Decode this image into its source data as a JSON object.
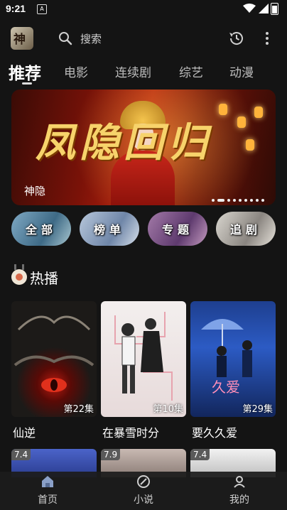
{
  "status_bar": {
    "time": "9:21"
  },
  "top_bar": {
    "logo_text": "神",
    "search_placeholder": "搜索"
  },
  "tabs": [
    {
      "label": "推荐",
      "active": true
    },
    {
      "label": "电影"
    },
    {
      "label": "连续剧"
    },
    {
      "label": "综艺"
    },
    {
      "label": "动漫"
    }
  ],
  "banner": {
    "title_art": "凤隐回归",
    "subtitle": "神隐",
    "slide_count": 9,
    "active_slide": 1
  },
  "categories": [
    {
      "label": "全部"
    },
    {
      "label": "榜单"
    },
    {
      "label": "专题"
    },
    {
      "label": "追剧"
    }
  ],
  "hot_section": {
    "title": "热播",
    "items": [
      {
        "title": "仙逆",
        "episode": "第22集"
      },
      {
        "title": "在暴雪时分",
        "episode": "第10集"
      },
      {
        "title": "要久久爱",
        "episode": "第29集"
      }
    ],
    "more_ratings": [
      "7.4",
      "7.9",
      "7.4"
    ]
  },
  "bottom_nav": [
    {
      "label": "首页",
      "icon": "home-icon"
    },
    {
      "label": "小说",
      "icon": "book-icon"
    },
    {
      "label": "我的",
      "icon": "profile-icon"
    }
  ]
}
